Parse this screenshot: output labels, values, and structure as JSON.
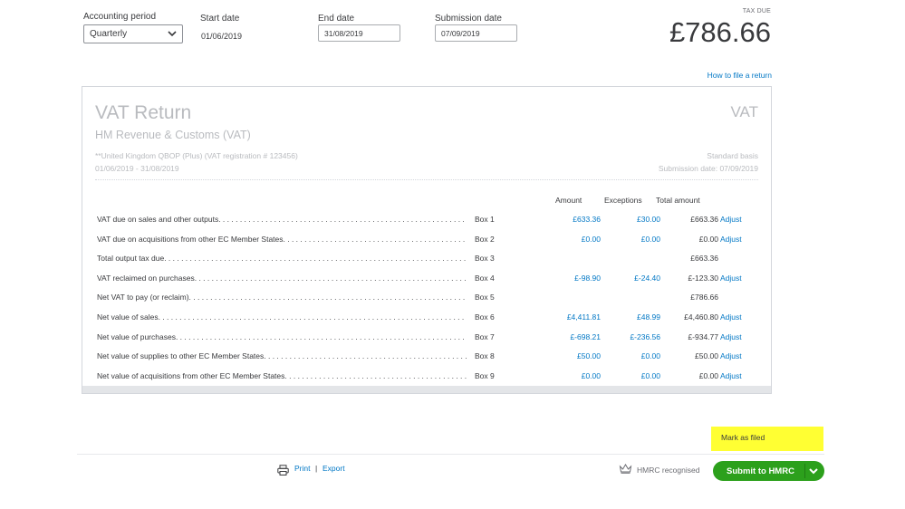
{
  "header": {
    "accounting_period_label": "Accounting period",
    "accounting_period_value": "Quarterly",
    "start_date_label": "Start date",
    "start_date_value": "01/06/2019",
    "end_date_label": "End date",
    "end_date_value": "31/08/2019",
    "submission_date_label": "Submission date",
    "submission_date_value": "07/09/2019",
    "tax_due_label": "TAX DUE",
    "tax_due_value": "£786.66",
    "how_to_link": "How to file a return"
  },
  "card": {
    "title": "VAT Return",
    "tag": "VAT",
    "subtitle": "HM Revenue & Customs (VAT)",
    "company_line": "**United Kingdom QBOP (Plus) (VAT registration # 123456)",
    "period": "01/06/2019 - 31/08/2019",
    "basis": "Standard basis",
    "submission_date": "Submission date: 07/09/2019",
    "columns": {
      "amount": "Amount",
      "exceptions": "Exceptions",
      "total": "Total amount"
    },
    "rows": [
      {
        "desc": "VAT due on sales and other outputs. . . . . . . . . . . . . . . . . . . . . . . . . . . . . . . . . . . . . . . . . . . . . . . . . . . . . . . . . . . . . . . . . . . . . . .",
        "box": "Box 1",
        "amount": "£633.36",
        "exceptions": "£30.00",
        "total": "£663.36",
        "adjust": "Adjust"
      },
      {
        "desc": "VAT due on acquisitions from other EC Member States. . . . . . . . . . . . . . . . . . . . . . . . . . . . . . . . . . . . . . . . . . . . . . . . . . . . . . . . . . . . . . . . . . . . . . .",
        "box": "Box 2",
        "amount": "£0.00",
        "exceptions": "£0.00",
        "total": "£0.00",
        "adjust": "Adjust"
      },
      {
        "desc": "Total output tax due. . . . . . . . . . . . . . . . . . . . . . . . . . . . . . . . . . . . . . . . . . . . . . . . . . . . . . . . . . . . . . . . . . . . . . . . . . . . . . . . . . . . . . . . . . . . . . . . . . . . . . . . . . .",
        "box": "Box 3",
        "amount": "",
        "exceptions": "",
        "total": "£663.36",
        "adjust": ""
      },
      {
        "desc": "VAT reclaimed on purchases. . . . . . . . . . . . . . . . . . . . . . . . . . . . . . . . . . . . . . . . . . . . . . . . . . . . . . . . . . . . . . . . . . . . . . . . . . . . . . . . . . . . . . . . . . . . . . . . . . . . . . . .",
        "box": "Box 4",
        "amount": "£-98.90",
        "exceptions": "£-24.40",
        "total": "£-123.30",
        "adjust": "Adjust"
      },
      {
        "desc": "Net VAT to pay (or reclaim). . . . . . . . . . . . . . . . . . . . . . . . . . . . . . . . . . . . . . . . . . . . . . . . . . . . . . . . . . . . . . . . . . . . . . . . . . . . . . . . . . . . . . . . . . . . . . . . . . . . . . . .",
        "box": "Box 5",
        "amount": "",
        "exceptions": "",
        "total": "£786.66",
        "adjust": ""
      },
      {
        "desc": "Net value of sales. . . . . . . . . . . . . . . . . . . . . . . . . . . . . . . . . . . . . . . . . . . . . . . . . . . . . . . . . . . . . . . . . . . . . . . . . . . . . . . . . . . . . . . . . . . . . . . . . . . . . . . . . . . . .",
        "box": "Box 6",
        "amount": "£4,411.81",
        "exceptions": "£48.99",
        "total": "£4,460.80",
        "adjust": "Adjust"
      },
      {
        "desc": "Net value of purchases. . . . . . . . . . . . . . . . . . . . . . . . . . . . . . . . . . . . . . . . . . . . . . . . . . . . . . . . . . . . . . . . . . . . . . . . . . . . . . . . . . . . . . . . . . . . . . . . . . . . . . . . . . .",
        "box": "Box 7",
        "amount": "£-698.21",
        "exceptions": "£-236.56",
        "total": "£-934.77",
        "adjust": "Adjust"
      },
      {
        "desc": "Net value of supplies to other EC Member States. . . . . . . . . . . . . . . . . . . . . . . . . . . . . . . . . . . . . . . . . . . . . . . . . . . . . . . . . . . . . . . . . . . . . . . . . . . . . . . . . . . .",
        "box": "Box 8",
        "amount": "£50.00",
        "exceptions": "£0.00",
        "total": "£50.00",
        "adjust": "Adjust"
      },
      {
        "desc": "Net value of acquisitions from other EC Member States. . . . . . . . . . . . . . . . . . . . . . . . . . . . . . . . . . . . . . . . . . . . . . . . . . . . . . . . . . . . . . . . . . . . . . . . . . . . . . . . . . .",
        "box": "Box 9",
        "amount": "£0.00",
        "exceptions": "£0.00",
        "total": "£0.00",
        "adjust": "Adjust"
      }
    ]
  },
  "actions": {
    "mark_as_filed": "Mark as filed",
    "print": "Print",
    "separator": "|",
    "export": "Export",
    "hmrc_recognised": "HMRC recognised",
    "submit": "Submit to HMRC"
  },
  "colors": {
    "link": "#0077c5",
    "submit_green": "#2ca01c",
    "highlight": "#ffff33",
    "faded_text": "#b9bbbf"
  },
  "icons": [
    "chevron-down-icon",
    "print-icon",
    "crown-icon",
    "caret-down-icon"
  ]
}
